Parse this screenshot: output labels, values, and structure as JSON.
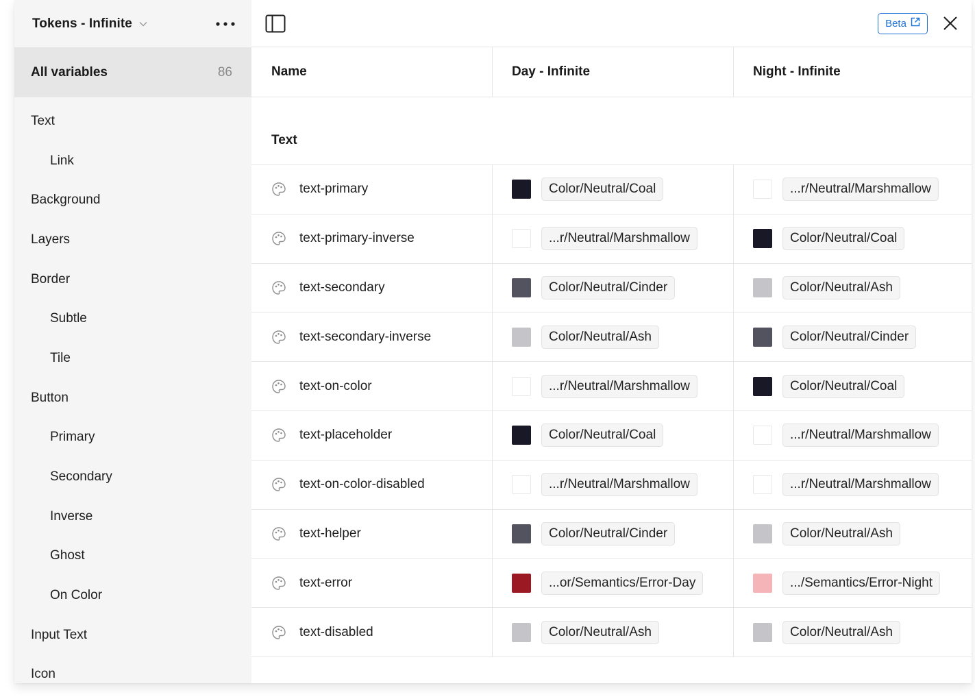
{
  "sidebar": {
    "collection_title": "Tokens - Infinite",
    "all_variables_label": "All variables",
    "all_variables_count": "86",
    "groups": [
      {
        "label": "Text",
        "level": 0
      },
      {
        "label": "Link",
        "level": 1
      },
      {
        "label": "Background",
        "level": 0
      },
      {
        "label": "Layers",
        "level": 0
      },
      {
        "label": "Border",
        "level": 0
      },
      {
        "label": "Subtle",
        "level": 1
      },
      {
        "label": "Tile",
        "level": 1
      },
      {
        "label": "Button",
        "level": 0
      },
      {
        "label": "Primary",
        "level": 1
      },
      {
        "label": "Secondary",
        "level": 1
      },
      {
        "label": "Inverse",
        "level": 1
      },
      {
        "label": "Ghost",
        "level": 1
      },
      {
        "label": "On Color",
        "level": 1
      },
      {
        "label": "Input Text",
        "level": 0
      },
      {
        "label": "Icon",
        "level": 0
      }
    ]
  },
  "topbar": {
    "beta_label": "Beta"
  },
  "table": {
    "headers": {
      "name": "Name",
      "day": "Day - Infinite",
      "night": "Night - Infinite"
    },
    "group_label": "Text",
    "rows": [
      {
        "name": "text-primary",
        "day": {
          "label": "Color/Neutral/Coal",
          "color": "#181826"
        },
        "night": {
          "label": "...r/Neutral/Marshmallow",
          "color": "#ffffff"
        }
      },
      {
        "name": "text-primary-inverse",
        "day": {
          "label": "...r/Neutral/Marshmallow",
          "color": "#ffffff"
        },
        "night": {
          "label": "Color/Neutral/Coal",
          "color": "#181826"
        }
      },
      {
        "name": "text-secondary",
        "day": {
          "label": "Color/Neutral/Cinder",
          "color": "#53525f"
        },
        "night": {
          "label": "Color/Neutral/Ash",
          "color": "#c5c4c9"
        }
      },
      {
        "name": "text-secondary-inverse",
        "day": {
          "label": "Color/Neutral/Ash",
          "color": "#c5c4c9"
        },
        "night": {
          "label": "Color/Neutral/Cinder",
          "color": "#53525f"
        }
      },
      {
        "name": "text-on-color",
        "day": {
          "label": "...r/Neutral/Marshmallow",
          "color": "#ffffff"
        },
        "night": {
          "label": "Color/Neutral/Coal",
          "color": "#181826"
        }
      },
      {
        "name": "text-placeholder",
        "day": {
          "label": "Color/Neutral/Coal",
          "color": "#181826"
        },
        "night": {
          "label": "...r/Neutral/Marshmallow",
          "color": "#ffffff"
        }
      },
      {
        "name": "text-on-color-disabled",
        "day": {
          "label": "...r/Neutral/Marshmallow",
          "color": "#ffffff"
        },
        "night": {
          "label": "...r/Neutral/Marshmallow",
          "color": "#ffffff"
        }
      },
      {
        "name": "text-helper",
        "day": {
          "label": "Color/Neutral/Cinder",
          "color": "#53525f"
        },
        "night": {
          "label": "Color/Neutral/Ash",
          "color": "#c5c4c9"
        }
      },
      {
        "name": "text-error",
        "day": {
          "label": "...or/Semantics/Error-Day",
          "color": "#9b1923"
        },
        "night": {
          "label": ".../Semantics/Error-Night",
          "color": "#f4b4b8"
        }
      },
      {
        "name": "text-disabled",
        "day": {
          "label": "Color/Neutral/Ash",
          "color": "#c5c4c9"
        },
        "night": {
          "label": "Color/Neutral/Ash",
          "color": "#c5c4c9"
        }
      }
    ]
  },
  "icons": {
    "collection_dropdown": "chevron-down-icon",
    "more": "more-horizontal-icon",
    "sidebar_toggle": "sidebar-panel-icon",
    "beta_link": "external-link-icon",
    "close": "close-icon",
    "variable_type": "palette-icon"
  },
  "colors": {
    "accent": "#1e72d8",
    "sidebar_bg": "#f5f5f5",
    "selected_bg": "#e6e6e6"
  }
}
